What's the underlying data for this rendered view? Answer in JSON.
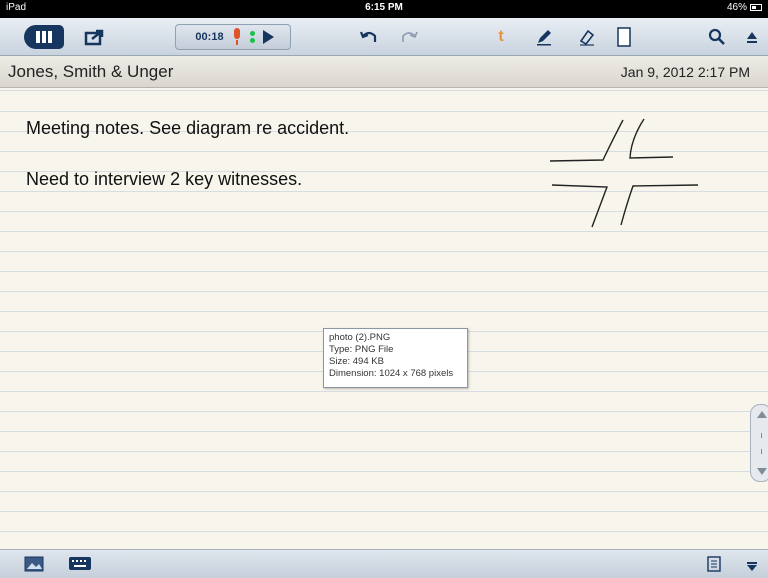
{
  "status_bar": {
    "carrier": "iPad",
    "time": "6:15 PM",
    "battery": "46%"
  },
  "toolbar": {
    "recording_time": "00:18",
    "icons": [
      "library-icon",
      "share-icon",
      "microphone-icon",
      "play-icon",
      "undo-icon",
      "redo-icon",
      "text-tool-icon",
      "pen-icon",
      "eraser-icon",
      "page-icon",
      "search-icon",
      "eject-icon"
    ],
    "accent": "#17365f",
    "text_tool_label": "t"
  },
  "document": {
    "title": "Jones, Smith & Unger",
    "date": "Jan 9, 2012 2:17 PM"
  },
  "notes": [
    "Meeting notes. See diagram re accident.",
    "Need to interview 2 key witnesses."
  ],
  "tooltip": {
    "lines": [
      "photo (2).PNG",
      "Type: PNG File",
      "Size: 494 KB",
      "Dimension: 1024 x 768 pixels"
    ]
  },
  "bottom_bar": {
    "icons": [
      "insert-image-icon",
      "keyboard-icon",
      "page-list-icon",
      "collapse-icon"
    ]
  }
}
